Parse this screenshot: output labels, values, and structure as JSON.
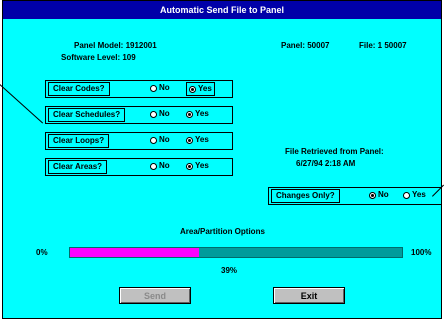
{
  "window": {
    "title": "Automatic Send File to Panel"
  },
  "info": {
    "panel_model": "Panel Model: 1912001",
    "software_level": "Software Level: 109",
    "panel_id": "Panel: 50007",
    "file_id": "File: 1 50007"
  },
  "options": [
    {
      "label": "Clear Codes?",
      "no": "No",
      "yes": "Yes",
      "value": "yes"
    },
    {
      "label": "Clear Schedules?",
      "no": "No",
      "yes": "Yes",
      "value": "yes"
    },
    {
      "label": "Clear Loops?",
      "no": "No",
      "yes": "Yes",
      "value": "yes"
    },
    {
      "label": "Clear Areas?",
      "no": "No",
      "yes": "Yes",
      "value": "yes"
    }
  ],
  "retrieved": {
    "label": "File Retrieved from Panel:",
    "datetime": "6/27/94 2:18 AM"
  },
  "changes_only": {
    "label": "Changes Only?",
    "no": "No",
    "yes": "Yes",
    "value": "no"
  },
  "progress": {
    "title": "Area/Partition Options",
    "min_label": "0%",
    "max_label": "100%",
    "value_label": "39%",
    "fraction": 0.39
  },
  "buttons": {
    "send": "Send",
    "exit": "Exit"
  },
  "colors": {
    "background": "#00ffff",
    "titlebar": "#0000a8",
    "fill": "#ff00ff",
    "track": "#009c9c"
  }
}
